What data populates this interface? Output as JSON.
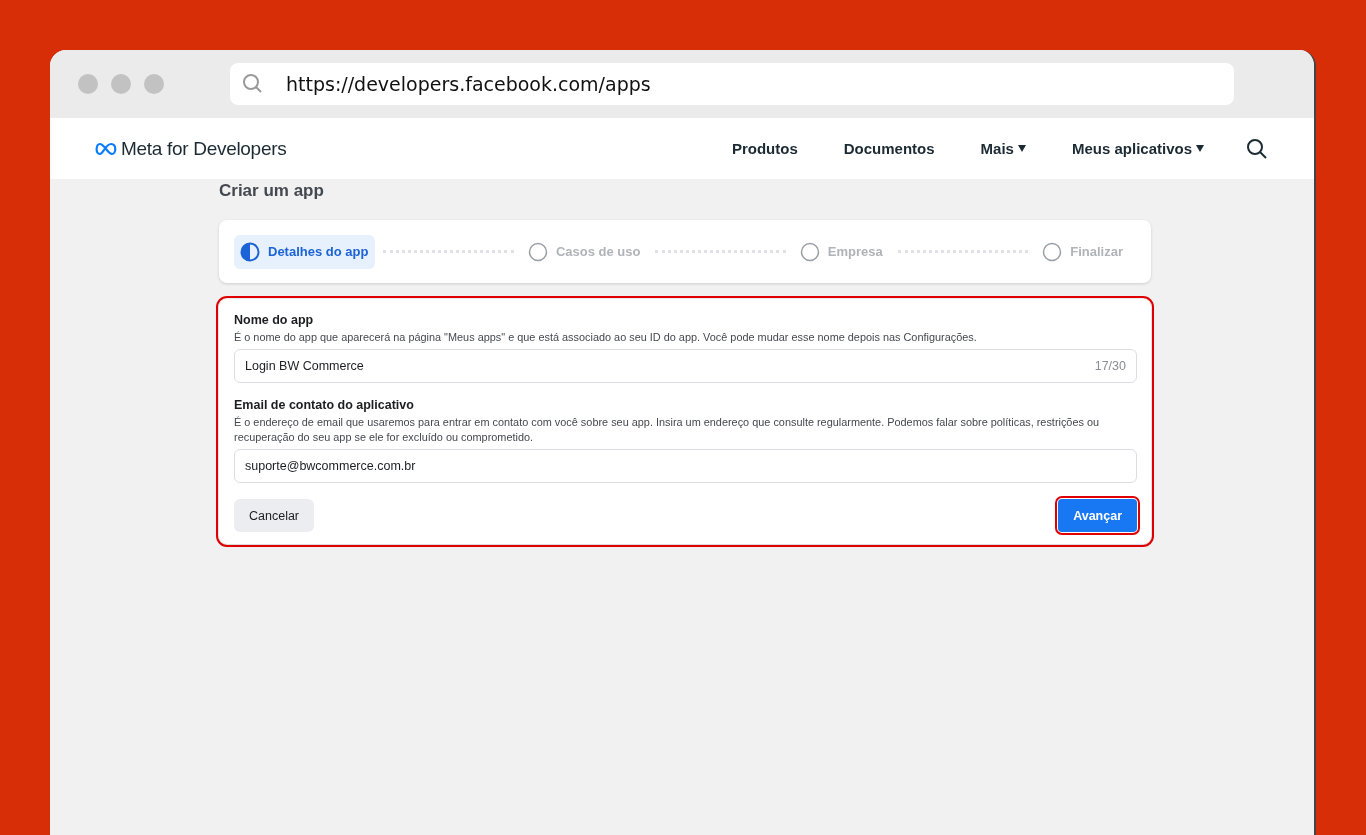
{
  "browser": {
    "url": "https://developers.facebook.com/apps"
  },
  "nav": {
    "brand": "Meta for Developers",
    "items": [
      {
        "label": "Produtos",
        "dropdown": false
      },
      {
        "label": "Documentos",
        "dropdown": false
      },
      {
        "label": "Mais",
        "dropdown": true
      },
      {
        "label": "Meus aplicativos",
        "dropdown": true
      }
    ]
  },
  "page_title": "Criar um app",
  "steps": [
    {
      "label": "Detalhes do app",
      "selected": true
    },
    {
      "label": "Casos de uso",
      "selected": false
    },
    {
      "label": "Empresa",
      "selected": false
    },
    {
      "label": "Finalizar",
      "selected": false
    }
  ],
  "form": {
    "highlighted": true,
    "fields": [
      {
        "label": "Nome do app",
        "help": "É o nome do app que aparecerá na página \"Meus apps\" e que está associado ao seu ID do app. Você pode mudar esse nome depois nas Configurações.",
        "value": "Login BW Commerce",
        "counter": "17/30"
      },
      {
        "label": "Email de contato do aplicativo",
        "help": "É o endereço de email que usaremos para entrar em contato com você sobre seu app. Insira um endereço que consulte regularmente. Podemos falar sobre políticas, restrições ou recuperação do seu app se ele for excluído ou comprometido.",
        "value": "suporte@bwcommerce.com.br"
      }
    ],
    "cancel": {
      "label": "Cancelar"
    },
    "next": {
      "label": "Avançar",
      "highlighted": true
    }
  }
}
